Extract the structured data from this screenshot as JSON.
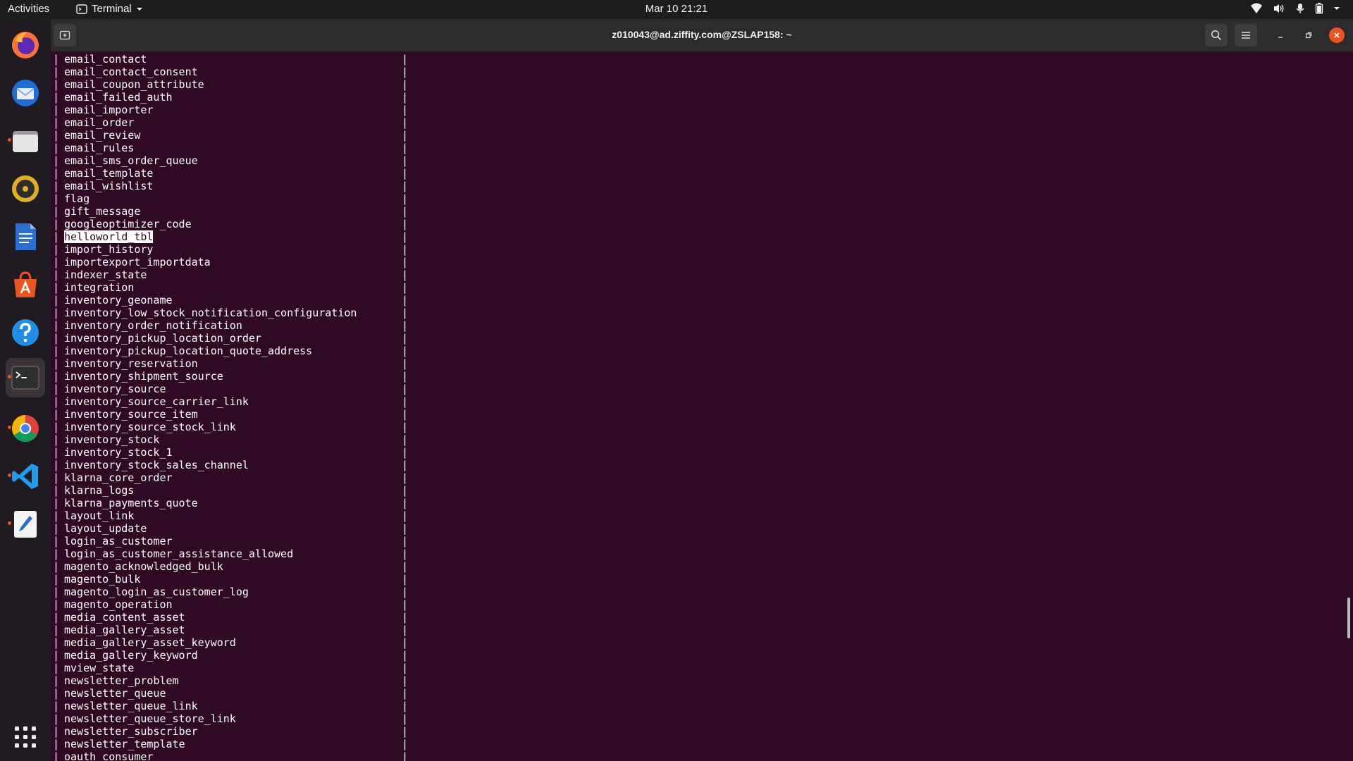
{
  "topbar": {
    "activities": "Activities",
    "app_name": "Terminal",
    "clock": "Mar 10  21:21"
  },
  "dock": {
    "apps": [
      {
        "name": "firefox-icon",
        "active": false
      },
      {
        "name": "thunderbird-icon",
        "active": false
      },
      {
        "name": "files-icon",
        "active": false
      },
      {
        "name": "rhythmbox-icon",
        "active": false
      },
      {
        "name": "libreoffice-writer-icon",
        "active": false
      },
      {
        "name": "ubuntu-software-icon",
        "active": false
      },
      {
        "name": "help-icon",
        "active": false
      },
      {
        "name": "terminal-icon",
        "active": true
      },
      {
        "name": "chrome-icon",
        "active": false
      },
      {
        "name": "vscode-icon",
        "active": false
      },
      {
        "name": "text-editor-icon",
        "active": false
      }
    ],
    "show_apps": "show-applications-icon"
  },
  "window": {
    "title": "z010043@ad.ziffity.com@ZSLAP158: ~"
  },
  "terminal": {
    "selected_row": 14,
    "rows": [
      "email_contact",
      "email_contact_consent",
      "email_coupon_attribute",
      "email_failed_auth",
      "email_importer",
      "email_order",
      "email_review",
      "email_rules",
      "email_sms_order_queue",
      "email_template",
      "email_wishlist",
      "flag",
      "gift_message",
      "googleoptimizer_code",
      "helloworld_tbl",
      "import_history",
      "importexport_importdata",
      "indexer_state",
      "integration",
      "inventory_geoname",
      "inventory_low_stock_notification_configuration",
      "inventory_order_notification",
      "inventory_pickup_location_order",
      "inventory_pickup_location_quote_address",
      "inventory_reservation",
      "inventory_shipment_source",
      "inventory_source",
      "inventory_source_carrier_link",
      "inventory_source_item",
      "inventory_source_stock_link",
      "inventory_stock",
      "inventory_stock_1",
      "inventory_stock_sales_channel",
      "klarna_core_order",
      "klarna_logs",
      "klarna_payments_quote",
      "layout_link",
      "layout_update",
      "login_as_customer",
      "login_as_customer_assistance_allowed",
      "magento_acknowledged_bulk",
      "magento_bulk",
      "magento_login_as_customer_log",
      "magento_operation",
      "media_content_asset",
      "media_gallery_asset",
      "media_gallery_asset_keyword",
      "media_gallery_keyword",
      "mview_state",
      "newsletter_problem",
      "newsletter_queue",
      "newsletter_queue_link",
      "newsletter_queue_store_link",
      "newsletter_subscriber",
      "newsletter_template",
      "oauth_consumer"
    ]
  },
  "colors": {
    "terminal_bg": "#300a24",
    "accent": "#e95420",
    "topbar_bg": "#1d1d1d",
    "headerbar_bg": "#2c2c2c"
  }
}
